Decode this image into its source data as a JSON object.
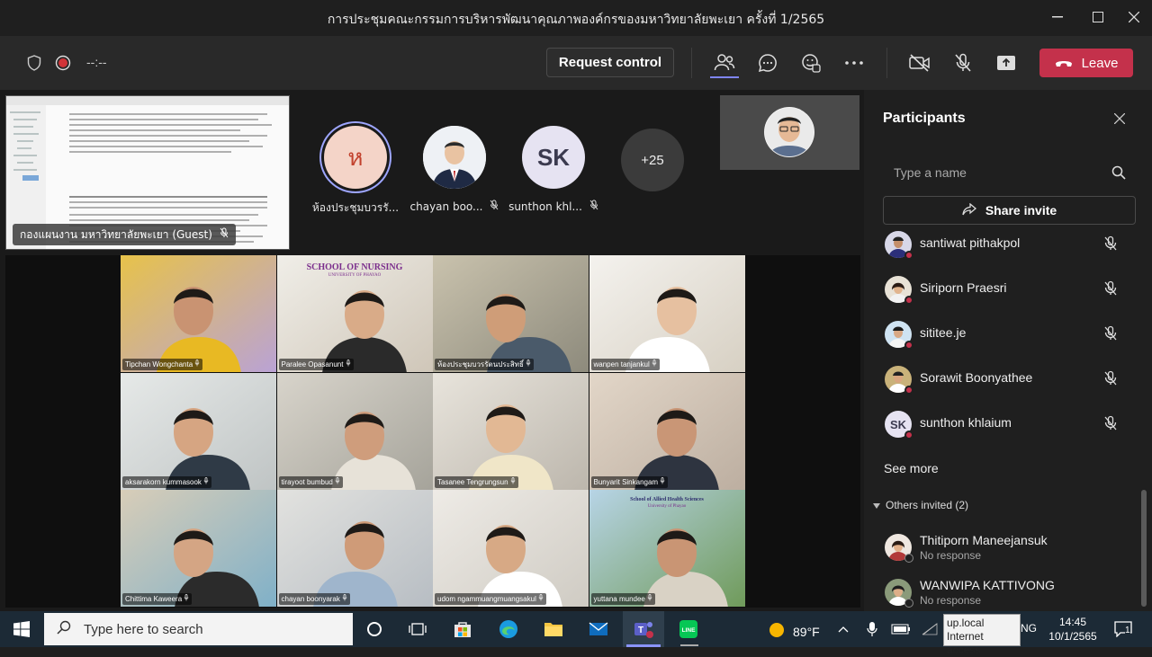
{
  "window": {
    "title": "การประชุมคณะกรรมการบริหารพัฒนาคุณภาพองค์กรของมหาวิทยาลัยพะเยา ครั้งที่ 1/2565"
  },
  "toolbar": {
    "timer": "--:--",
    "request_control": "Request control",
    "leave": "Leave"
  },
  "share": {
    "presenter_label": "กองแผนงาน มหาวิทยาลัยพะเยา (Guest)"
  },
  "avatars": [
    {
      "initial": "ห",
      "name": "ห้องประชุมบวรรั..."
    },
    {
      "name": "chayan boo..."
    },
    {
      "initial": "SK",
      "name": "sunthon khl..."
    },
    {
      "initial": "+25"
    }
  ],
  "grid": [
    {
      "name": "Tipchan Wongchanta"
    },
    {
      "name": "Paralee Opasanunt",
      "caption": "SCHOOL OF NURSING",
      "subcaption": "UNIVERSITY OF PHAYAO"
    },
    {
      "name": "ห้องประชุมบวรรัตนประสิทธิ์"
    },
    {
      "name": "wanpen tanjankul"
    },
    {
      "name": "aksarakorn kummasook"
    },
    {
      "name": "tirayoot bumbud"
    },
    {
      "name": "Tasanee Tengrungsun"
    },
    {
      "name": "Bunyarit Sinkangam"
    },
    {
      "name": "Chittima Kaweera"
    },
    {
      "name": "chayan boonyarak"
    },
    {
      "name": "udom ngammuangmuangsakul"
    },
    {
      "name": "yuttana mundee",
      "caption": "School of Allied Health Sciences",
      "subcaption": "University of Phayao"
    }
  ],
  "panel": {
    "title": "Participants",
    "search_placeholder": "Type a name",
    "share_invite": "Share invite",
    "participants": [
      {
        "name": "santiwat pithakpol"
      },
      {
        "name": "Siriporn Praesri"
      },
      {
        "name": "sititee.je"
      },
      {
        "name": "Sorawit Boonyathee"
      },
      {
        "name": "sunthon khlaium",
        "initials": "SK"
      }
    ],
    "see_more": "See more",
    "others_invited": "Others invited (2)",
    "invited": [
      {
        "name": "Thitiporn Maneejansuk",
        "status": "No response"
      },
      {
        "name": "WANWIPA KATTIVONG",
        "status": "No response"
      }
    ]
  },
  "taskbar": {
    "search_placeholder": "Type here to search",
    "weather": "89°F",
    "tooltip_line1": "up.local",
    "tooltip_line2": "Internet access",
    "lang": "NG",
    "time": "14:45",
    "date": "10/1/2565",
    "notif_count": "1"
  },
  "colors": {
    "leave": "#c4314b",
    "panel_bg": "#1f1f1f",
    "toolbar_bg": "#292929",
    "taskbar_bg": "#1c2a36"
  }
}
